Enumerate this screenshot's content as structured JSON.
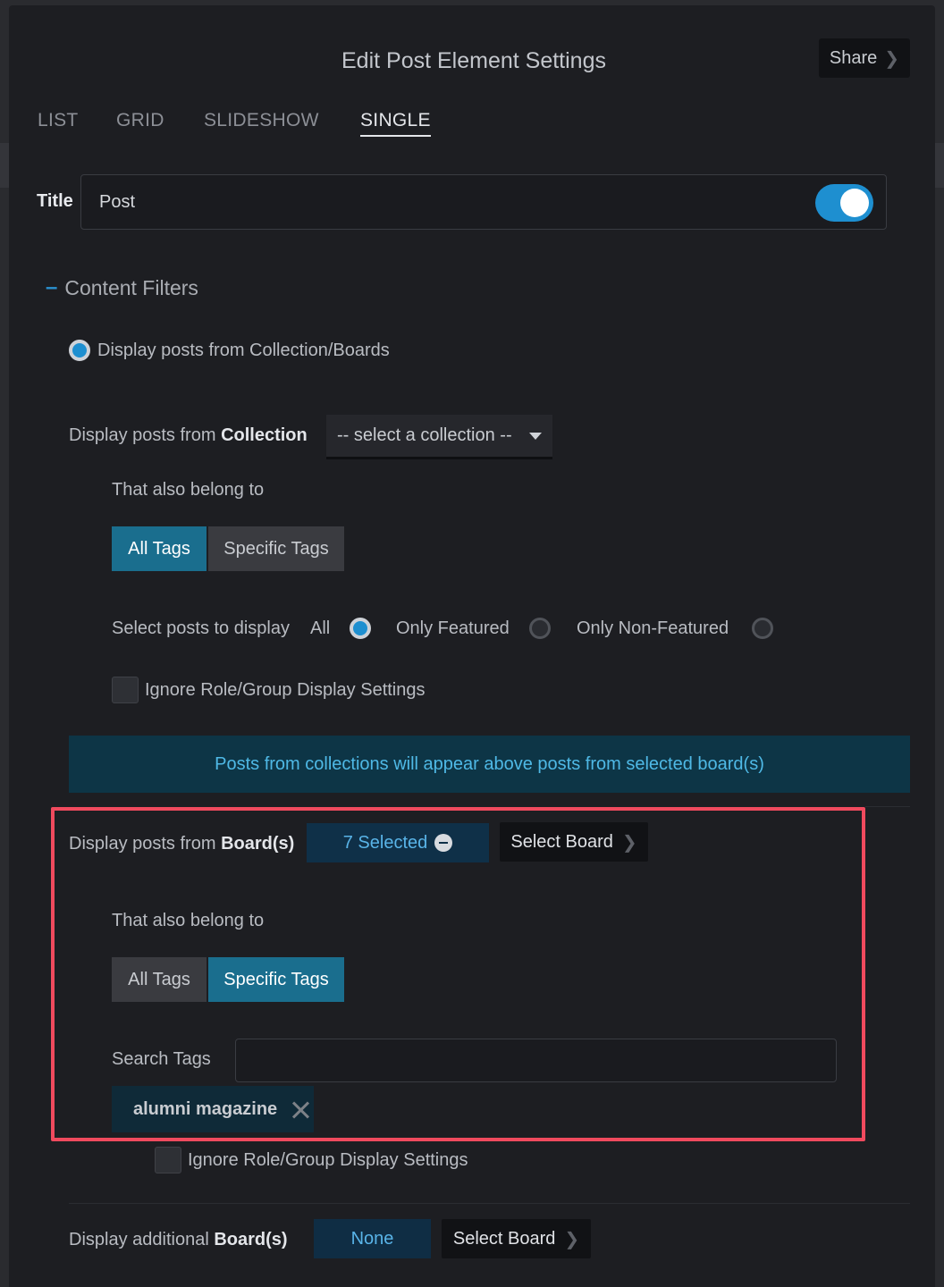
{
  "header": {
    "title": "Edit Post Element Settings",
    "share_label": "Share"
  },
  "tabs": [
    {
      "label": "LIST",
      "active": false
    },
    {
      "label": "GRID",
      "active": false
    },
    {
      "label": "SLIDESHOW",
      "active": false
    },
    {
      "label": "SINGLE",
      "active": true
    }
  ],
  "title_field": {
    "label": "Title",
    "value": "Post",
    "toggle_on": true
  },
  "content_filters": {
    "heading": "Content Filters",
    "source_option": "Display posts from Collection/Boards",
    "collection": {
      "label_prefix": "Display posts from ",
      "label_bold": "Collection",
      "dropdown_value": "-- select a collection --",
      "also_belong": "That also belong to",
      "tags_all": "All Tags",
      "tags_specific": "Specific Tags",
      "tags_selected": "All Tags",
      "select_posts_label": "Select posts to display",
      "options": [
        "All",
        "Only Featured",
        "Only Non-Featured"
      ],
      "option_selected": "All",
      "ignore_label": "Ignore Role/Group Display Settings"
    },
    "banner": "Posts from collections will appear above posts from selected board(s)",
    "boards": {
      "label_prefix": "Display posts from ",
      "label_bold": "Board(s)",
      "selected_label": "7 Selected",
      "select_board": "Select Board",
      "also_belong": "That also belong to",
      "tags_all": "All Tags",
      "tags_specific": "Specific Tags",
      "tags_selected": "Specific Tags",
      "search_label": "Search Tags",
      "search_value": "",
      "tags": [
        "alumni magazine"
      ],
      "ignore_label": "Ignore Role/Group Display Settings"
    },
    "additional": {
      "label_prefix": "Display additional ",
      "label_bold": "Board(s)",
      "none_label": "None",
      "select_board": "Select Board"
    }
  },
  "colors": {
    "accent": "#1e8fd0",
    "highlight": "#f04a5e",
    "segment_selected": "#1a6e8e",
    "banner_bg": "#0d3546"
  }
}
